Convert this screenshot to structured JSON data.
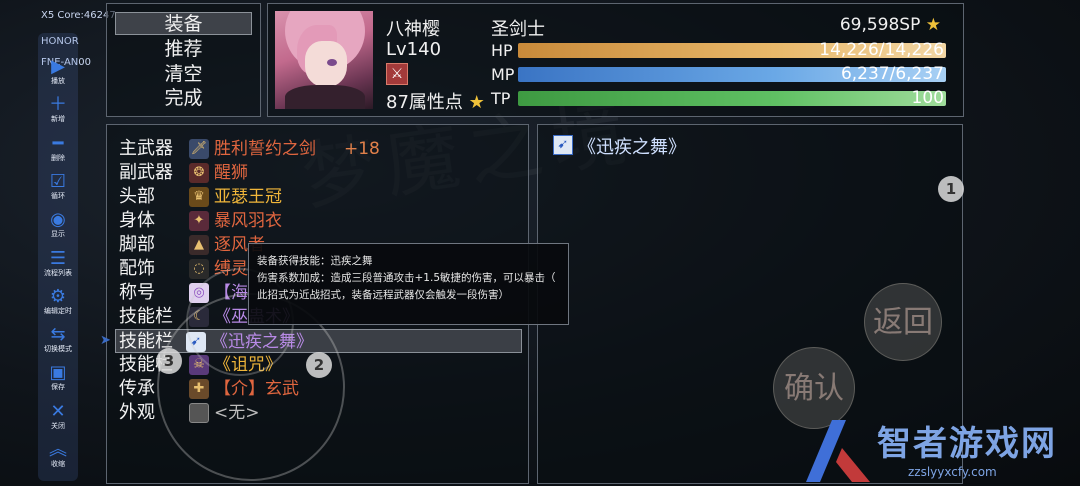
{
  "overlay": {
    "core_text": "X5 Core:46247",
    "device_brand": "HONOR",
    "device_model": "FNE-AN00"
  },
  "menu": {
    "items": [
      "装备",
      "推荐",
      "清空",
      "完成"
    ],
    "selected_index": 0
  },
  "character": {
    "name": "八神樱",
    "job": "圣剑士",
    "level": "Lv140",
    "attribute_points": "87属性点",
    "sp": "69,598SP",
    "hp_label": "HP",
    "hp_value": "14,226/14,226",
    "hp_fraction": 1.0,
    "mp_label": "MP",
    "mp_value": "6,237/6,237",
    "mp_fraction": 1.0,
    "tp_label": "TP",
    "tp_value": "100",
    "tp_fraction": 1.0,
    "colors": {
      "hp": "#e0a24a",
      "mp": "#4a8fd6",
      "tp": "#4caf50"
    }
  },
  "equipment": [
    {
      "slot": "主武器",
      "name": "胜利誓约之剑",
      "bonus": "+18",
      "color": "#e0663f",
      "icon": "sword-icon"
    },
    {
      "slot": "副武器",
      "name": "醒狮",
      "bonus": "",
      "color": "#e0663f",
      "icon": "lion-icon"
    },
    {
      "slot": "头部",
      "name": "亚瑟王冠",
      "bonus": "",
      "color": "#f0b63a",
      "icon": "crown-icon"
    },
    {
      "slot": "身体",
      "name": "暴风羽衣",
      "bonus": "",
      "color": "#e0663f",
      "icon": "armor-icon"
    },
    {
      "slot": "脚部",
      "name": "逐风者",
      "bonus": "",
      "color": "#e0663f",
      "icon": "boots-icon"
    },
    {
      "slot": "配饰",
      "name": "缚灵",
      "bonus": "",
      "color": "#e0663f",
      "icon": "accessory-icon"
    },
    {
      "slot": "称号",
      "name": "【海",
      "bonus": "",
      "color": "#b88ae6",
      "icon": "title-icon"
    },
    {
      "slot": "技能栏",
      "name": "《巫蛊术》",
      "bonus": "",
      "color": "#b88ae6",
      "icon": "skill-icon"
    },
    {
      "slot": "技能栏",
      "name": "《迅疾之舞》",
      "bonus": "",
      "color": "#b88ae6",
      "icon": "dash-skill-icon"
    },
    {
      "slot": "技能栏",
      "name": "《诅咒》",
      "bonus": "",
      "color": "#f0b63a",
      "icon": "curse-skill-icon"
    },
    {
      "slot": "传承",
      "name": "【介】玄武",
      "bonus": "",
      "color": "#e0663f",
      "icon": "heritage-icon"
    },
    {
      "slot": "外观",
      "name": "<无>",
      "bonus": "",
      "color": "#bdbdbd",
      "icon": "empty-slot-icon"
    }
  ],
  "selected_equipment_index": 8,
  "tooltip": {
    "line1": "装备获得技能：迅疾之舞",
    "line2": "伤害系数加成：造成三段普通攻击+1.5敏捷的伤害，可以暴击（",
    "line3": "此招式为近战招式，装备远程武器仅会触发一段伤害）"
  },
  "skill_panel": {
    "title": "《迅疾之舞》"
  },
  "toolbar": [
    {
      "label": "播放",
      "icon": "play-icon"
    },
    {
      "label": "新增",
      "icon": "plus-icon"
    },
    {
      "label": "删除",
      "icon": "minus-icon"
    },
    {
      "label": "循环",
      "icon": "loop-icon"
    },
    {
      "label": "显示",
      "icon": "eye-icon"
    },
    {
      "label": "流程列表",
      "icon": "list-icon"
    },
    {
      "label": "编辑定时",
      "icon": "timer-icon"
    },
    {
      "label": "切换模式",
      "icon": "switch-icon"
    },
    {
      "label": "保存",
      "icon": "save-icon"
    },
    {
      "label": "关闭",
      "icon": "close-icon"
    },
    {
      "label": "收缩",
      "icon": "collapse-icon"
    }
  ],
  "markers": [
    "1",
    "2",
    "3"
  ],
  "buttons": {
    "back": "返回",
    "confirm": "确认"
  },
  "watermark": {
    "main": "智者游戏网",
    "sub": "zzslyyxcfy.com"
  }
}
